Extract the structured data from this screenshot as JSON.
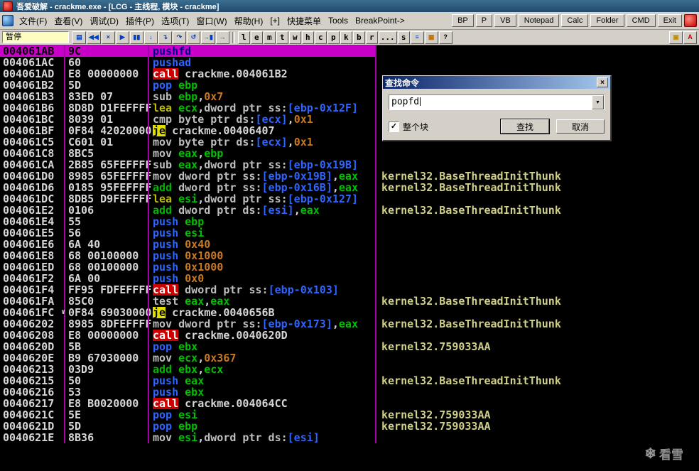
{
  "window": {
    "title": "吾爱破解 - crackme.exe - [LCG - 主线程, 模块 - crackme]"
  },
  "menu": {
    "items": [
      "文件(F)",
      "查看(V)",
      "调试(D)",
      "插件(P)",
      "选项(T)",
      "窗口(W)",
      "帮助(H)",
      "[+]",
      "快捷菜单",
      "Tools",
      "BreakPoint->"
    ],
    "buttons": [
      "BP",
      "P",
      "VB",
      "Notepad",
      "Calc",
      "Folder",
      "CMD",
      "Exit"
    ]
  },
  "toolbar": {
    "status": "暂停",
    "icons": [
      {
        "name": "open-file-icon",
        "glyph": "▤"
      },
      {
        "name": "restart-icon",
        "glyph": "◀◀"
      },
      {
        "name": "close-program-icon",
        "glyph": "×"
      },
      {
        "name": "run-icon",
        "glyph": "▶"
      },
      {
        "name": "pause-icon",
        "glyph": "▮▮"
      },
      {
        "name": "step-into-icon",
        "glyph": "↓"
      },
      {
        "name": "step-over-icon",
        "glyph": "↴"
      },
      {
        "name": "trace-into-icon",
        "glyph": "↷"
      },
      {
        "name": "trace-over-icon",
        "glyph": "↺"
      },
      {
        "name": "execute-till-return-icon",
        "glyph": "→▮"
      },
      {
        "name": "go-to-icon",
        "glyph": "→"
      }
    ],
    "letters": [
      "l",
      "e",
      "m",
      "t",
      "w",
      "h",
      "c",
      "p",
      "k",
      "b",
      "r",
      "...",
      "s"
    ],
    "extra_icons": [
      {
        "name": "options-icon",
        "glyph": "≡",
        "color": "#0040c0"
      },
      {
        "name": "appearance-icon",
        "glyph": "▦",
        "color": "#c07000"
      },
      {
        "name": "help-icon",
        "glyph": "?",
        "color": "#000000"
      }
    ],
    "right_icons": [
      {
        "name": "skin-icon",
        "glyph": "▣",
        "color": "#c09000"
      },
      {
        "name": "about-icon",
        "glyph": "A",
        "color": "#c00000"
      }
    ]
  },
  "icons": {
    "close": "×",
    "dropdown": "▼",
    "check": "✓",
    "snowflake": "❄"
  },
  "disasm": {
    "rows": [
      {
        "a": "004061AB",
        "b": "9C",
        "sel": true,
        "t": [
          [
            "pushfd",
            "st"
          ]
        ],
        "c": ""
      },
      {
        "a": "004061AC",
        "b": "60",
        "t": [
          [
            "pushad",
            "st"
          ]
        ],
        "c": ""
      },
      {
        "a": "004061AD",
        "b": "E8 00000000",
        "t": [
          [
            "call",
            "call"
          ],
          [
            " crackme.004061B2",
            "txt"
          ]
        ],
        "c": ""
      },
      {
        "a": "004061B2",
        "b": "5D",
        "t": [
          [
            "pop",
            "st"
          ],
          [
            " ",
            "txt"
          ],
          [
            "ebp",
            "reg"
          ]
        ],
        "c": ""
      },
      {
        "a": "004061B3",
        "b": "83ED 07",
        "t": [
          [
            "sub",
            "mn"
          ],
          [
            " ",
            "txt"
          ],
          [
            "ebp",
            "reg"
          ],
          [
            ",",
            "txt"
          ],
          [
            "0x7",
            "num"
          ]
        ],
        "c": ""
      },
      {
        "a": "004061B6",
        "b": "8D8D D1FEFFFF",
        "t": [
          [
            "lea",
            "lea"
          ],
          [
            " ",
            "txt"
          ],
          [
            "ecx",
            "reg"
          ],
          [
            ",",
            "txt"
          ],
          [
            "dword ptr ss:",
            "ptr"
          ],
          [
            "[ebp-0x12F]",
            "mem"
          ]
        ],
        "c": ""
      },
      {
        "a": "004061BC",
        "b": "8039 01",
        "t": [
          [
            "cmp",
            "mn"
          ],
          [
            " ",
            "txt"
          ],
          [
            "byte ptr ds:",
            "ptr"
          ],
          [
            "[ecx]",
            "mem"
          ],
          [
            ",",
            "txt"
          ],
          [
            "0x1",
            "num"
          ]
        ],
        "c": ""
      },
      {
        "a": "004061BF",
        "b": "0F84 42020000",
        "t": [
          [
            "je",
            "je"
          ],
          [
            " crackme.00406407",
            "txt"
          ]
        ],
        "c": ""
      },
      {
        "a": "004061C5",
        "b": "C601 01",
        "t": [
          [
            "mov",
            "mn"
          ],
          [
            " ",
            "txt"
          ],
          [
            "byte ptr ds:",
            "ptr"
          ],
          [
            "[ecx]",
            "mem"
          ],
          [
            ",",
            "txt"
          ],
          [
            "0x1",
            "num"
          ]
        ],
        "c": ""
      },
      {
        "a": "004061C8",
        "b": "8BC5",
        "t": [
          [
            "mov",
            "mn"
          ],
          [
            " ",
            "txt"
          ],
          [
            "eax",
            "reg"
          ],
          [
            ",",
            "txt"
          ],
          [
            "ebp",
            "reg"
          ]
        ],
        "c": ""
      },
      {
        "a": "004061CA",
        "b": "2B85 65FEFFFF",
        "t": [
          [
            "sub",
            "mn"
          ],
          [
            " ",
            "txt"
          ],
          [
            "eax",
            "reg"
          ],
          [
            ",",
            "txt"
          ],
          [
            "dword ptr ss:",
            "ptr"
          ],
          [
            "[ebp-0x19B]",
            "mem"
          ]
        ],
        "c": ""
      },
      {
        "a": "004061D0",
        "b": "8985 65FEFFFF",
        "t": [
          [
            "mov",
            "mn"
          ],
          [
            " ",
            "txt"
          ],
          [
            "dword ptr ss:",
            "ptr"
          ],
          [
            "[ebp-0x19B]",
            "mem"
          ],
          [
            ",",
            "txt"
          ],
          [
            "eax",
            "reg"
          ]
        ],
        "c": "kernel32.BaseThreadInitThunk"
      },
      {
        "a": "004061D6",
        "b": "0185 95FEFFFF",
        "t": [
          [
            "add",
            "add"
          ],
          [
            " ",
            "txt"
          ],
          [
            "dword ptr ss:",
            "ptr"
          ],
          [
            "[ebp-0x16B]",
            "mem"
          ],
          [
            ",",
            "txt"
          ],
          [
            "eax",
            "reg"
          ]
        ],
        "c": "kernel32.BaseThreadInitThunk"
      },
      {
        "a": "004061DC",
        "b": "8DB5 D9FEFFFF",
        "t": [
          [
            "lea",
            "lea"
          ],
          [
            " ",
            "txt"
          ],
          [
            "esi",
            "reg"
          ],
          [
            ",",
            "txt"
          ],
          [
            "dword ptr ss:",
            "ptr"
          ],
          [
            "[ebp-0x127]",
            "mem"
          ]
        ],
        "c": ""
      },
      {
        "a": "004061E2",
        "b": "0106",
        "t": [
          [
            "add",
            "add"
          ],
          [
            " ",
            "txt"
          ],
          [
            "dword ptr ds:",
            "ptr"
          ],
          [
            "[esi]",
            "mem"
          ],
          [
            ",",
            "txt"
          ],
          [
            "eax",
            "reg"
          ]
        ],
        "c": "kernel32.BaseThreadInitThunk"
      },
      {
        "a": "004061E4",
        "b": "55",
        "t": [
          [
            "push",
            "st"
          ],
          [
            " ",
            "txt"
          ],
          [
            "ebp",
            "reg"
          ]
        ],
        "c": ""
      },
      {
        "a": "004061E5",
        "b": "56",
        "t": [
          [
            "push",
            "st"
          ],
          [
            " ",
            "txt"
          ],
          [
            "esi",
            "reg"
          ]
        ],
        "c": ""
      },
      {
        "a": "004061E6",
        "b": "6A 40",
        "t": [
          [
            "push",
            "st"
          ],
          [
            " ",
            "txt"
          ],
          [
            "0x40",
            "num"
          ]
        ],
        "c": ""
      },
      {
        "a": "004061E8",
        "b": "68 00100000",
        "t": [
          [
            "push",
            "st"
          ],
          [
            " ",
            "txt"
          ],
          [
            "0x1000",
            "num"
          ]
        ],
        "c": ""
      },
      {
        "a": "004061ED",
        "b": "68 00100000",
        "t": [
          [
            "push",
            "st"
          ],
          [
            " ",
            "txt"
          ],
          [
            "0x1000",
            "num"
          ]
        ],
        "c": ""
      },
      {
        "a": "004061F2",
        "b": "6A 00",
        "t": [
          [
            "push",
            "st"
          ],
          [
            " ",
            "txt"
          ],
          [
            "0x0",
            "num"
          ]
        ],
        "c": ""
      },
      {
        "a": "004061F4",
        "b": "FF95 FDFEFFFF",
        "t": [
          [
            "call",
            "call"
          ],
          [
            " ",
            "txt"
          ],
          [
            "dword ptr ss:",
            "ptr"
          ],
          [
            "[ebp-0x103]",
            "mem"
          ]
        ],
        "c": ""
      },
      {
        "a": "004061FA",
        "b": "85C0",
        "t": [
          [
            "test",
            "mn"
          ],
          [
            " ",
            "txt"
          ],
          [
            "eax",
            "reg"
          ],
          [
            ",",
            "txt"
          ],
          [
            "eax",
            "reg"
          ]
        ],
        "c": "kernel32.BaseThreadInitThunk"
      },
      {
        "a": "004061FC",
        "b": "0F84 69030000",
        "m": "∨",
        "t": [
          [
            "je",
            "je"
          ],
          [
            " crackme.0040656B",
            "txt"
          ]
        ],
        "c": ""
      },
      {
        "a": "00406202",
        "b": "8985 8DFEFFFF",
        "t": [
          [
            "mov",
            "mn"
          ],
          [
            " ",
            "txt"
          ],
          [
            "dword ptr ss:",
            "ptr"
          ],
          [
            "[ebp-0x173]",
            "mem"
          ],
          [
            ",",
            "txt"
          ],
          [
            "eax",
            "reg"
          ]
        ],
        "c": "kernel32.BaseThreadInitThunk"
      },
      {
        "a": "00406208",
        "b": "E8 00000000",
        "t": [
          [
            "call",
            "call"
          ],
          [
            " crackme.0040620D",
            "txt"
          ]
        ],
        "c": ""
      },
      {
        "a": "0040620D",
        "b": "5B",
        "t": [
          [
            "pop",
            "st"
          ],
          [
            " ",
            "txt"
          ],
          [
            "ebx",
            "reg"
          ]
        ],
        "c": "kernel32.759033AA"
      },
      {
        "a": "0040620E",
        "b": "B9 67030000",
        "t": [
          [
            "mov",
            "mn"
          ],
          [
            " ",
            "txt"
          ],
          [
            "ecx",
            "reg"
          ],
          [
            ",",
            "txt"
          ],
          [
            "0x367",
            "num"
          ]
        ],
        "c": ""
      },
      {
        "a": "00406213",
        "b": "03D9",
        "t": [
          [
            "add",
            "add"
          ],
          [
            " ",
            "txt"
          ],
          [
            "ebx",
            "reg"
          ],
          [
            ",",
            "txt"
          ],
          [
            "ecx",
            "reg"
          ]
        ],
        "c": ""
      },
      {
        "a": "00406215",
        "b": "50",
        "t": [
          [
            "push",
            "st"
          ],
          [
            " ",
            "txt"
          ],
          [
            "eax",
            "reg"
          ]
        ],
        "c": "kernel32.BaseThreadInitThunk"
      },
      {
        "a": "00406216",
        "b": "53",
        "t": [
          [
            "push",
            "st"
          ],
          [
            " ",
            "txt"
          ],
          [
            "ebx",
            "reg"
          ]
        ],
        "c": ""
      },
      {
        "a": "00406217",
        "b": "E8 B0020000",
        "t": [
          [
            "call",
            "call"
          ],
          [
            " crackme.004064CC",
            "txt"
          ]
        ],
        "c": ""
      },
      {
        "a": "0040621C",
        "b": "5E",
        "t": [
          [
            "pop",
            "st"
          ],
          [
            " ",
            "txt"
          ],
          [
            "esi",
            "reg"
          ]
        ],
        "c": "kernel32.759033AA"
      },
      {
        "a": "0040621D",
        "b": "5D",
        "t": [
          [
            "pop",
            "st"
          ],
          [
            " ",
            "txt"
          ],
          [
            "ebp",
            "reg"
          ]
        ],
        "c": "kernel32.759033AA"
      },
      {
        "a": "0040621E",
        "b": "8B36",
        "t": [
          [
            "mov",
            "mn"
          ],
          [
            " ",
            "txt"
          ],
          [
            "esi",
            "reg"
          ],
          [
            ",",
            "txt"
          ],
          [
            "dword ptr ds:",
            "ptr"
          ],
          [
            "[esi]",
            "mem"
          ]
        ],
        "c": ""
      }
    ]
  },
  "dialog": {
    "title": "查找命令",
    "input_value": "popfd",
    "checkbox_checked": true,
    "checkbox_label": "整个块",
    "find_label": "查找",
    "cancel_label": "取消"
  },
  "watermark": {
    "text": "看雪"
  }
}
